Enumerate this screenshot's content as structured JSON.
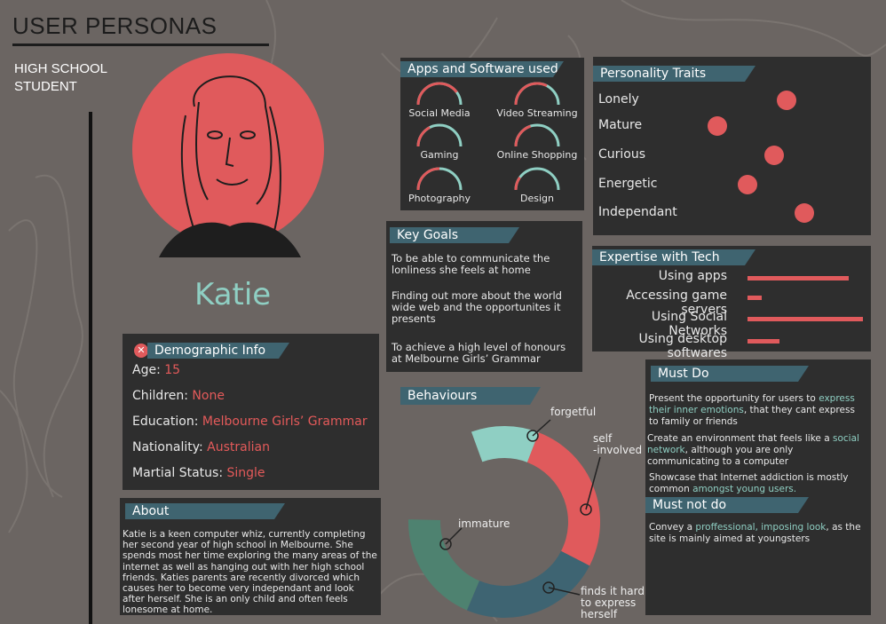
{
  "page": {
    "title": "USER PERSONAS",
    "subtitle": "HIGH SCHOOL STUDENT",
    "persona_name": "Katie"
  },
  "demographic": {
    "header": "Demographic Info",
    "rows": [
      {
        "label": "Age:",
        "value": "15"
      },
      {
        "label": "Children:",
        "value": "None"
      },
      {
        "label": "Education:",
        "value": "Melbourne Girls’ Grammar"
      },
      {
        "label": "Nationality:",
        "value": "Australian"
      },
      {
        "label": "Martial Status:",
        "value": "Single"
      }
    ]
  },
  "about": {
    "header": "About",
    "text": "Katie is a keen computer whiz, currently completing her second year of high school in Melbourne. She spends most her time exploring the many areas of the internet as well as hanging out with her high school friends. Katies parents are recently divorced which causes her to become very independant and look after herself. She is an only child and often feels lonesome at home."
  },
  "apps": {
    "header": "Apps and Software used",
    "items": [
      {
        "label": "Social Media",
        "level": 0.8
      },
      {
        "label": "Video Streaming",
        "level": 0.65
      },
      {
        "label": "Gaming",
        "level": 0.35
      },
      {
        "label": "Online Shopping",
        "level": 0.4
      },
      {
        "label": "Photography",
        "level": 0.5
      },
      {
        "label": "Design",
        "level": 0.2
      }
    ]
  },
  "goals": {
    "header": "Key Goals",
    "items": [
      "To be able to communicate the lonliness she feels at home",
      "Finding out more about the world wide web and the opportunites it presents",
      "To achieve a high level of honours at Melbourne Girls’ Grammar"
    ]
  },
  "traits": {
    "header": "Personality Traits",
    "items": [
      {
        "label": "Lonely",
        "level": 0.78
      },
      {
        "label": "Mature",
        "level": 0.5
      },
      {
        "label": "Curious",
        "level": 0.73
      },
      {
        "label": "Energetic",
        "level": 0.62
      },
      {
        "label": "Independant",
        "level": 0.85
      }
    ]
  },
  "tech": {
    "header": "Expertise with Tech",
    "items": [
      {
        "label": "Using apps",
        "level": 0.88
      },
      {
        "label": "Accessing game servers",
        "level": 0.12
      },
      {
        "label": "Using Social Networks",
        "level": 1.0
      },
      {
        "label": "Using desktop softwares",
        "level": 0.28
      }
    ]
  },
  "behaviours": {
    "header": "Behaviours"
  },
  "chart_data": {
    "type": "donut",
    "series": [
      {
        "name": "forgetful",
        "value": 12
      },
      {
        "name": "self -involved",
        "value": 28
      },
      {
        "name": "finds it hard to express herself",
        "value": 25
      },
      {
        "name": "immature",
        "value": 20
      }
    ],
    "labels": {
      "forgetful": "forgetful",
      "self_1": "self",
      "self_2": "-involved",
      "finds_1": "finds it hard",
      "finds_2": "to express",
      "finds_3": "herself",
      "immature": "immature"
    },
    "colors": [
      "#8fcfc3",
      "#e05a5c",
      "#3e6472",
      "#4e8270"
    ]
  },
  "mustdo": {
    "header": "Must Do",
    "p1_a": "Present the opportunity for users to ",
    "p1_b": "express their inner emotions",
    "p1_c": ", that they cant express to family or friends",
    "p2_a": "Create an environment that feels like a ",
    "p2_b": "social network",
    "p2_c": ", although you are only communicating to a computer",
    "p3_a": "Showcase that Internet addiction is mostly common ",
    "p3_b": "amongst young users."
  },
  "mustnot": {
    "header": "Must not do",
    "p1_a": "Convey a ",
    "p1_b": "proffessional, imposing look",
    "p1_c": ", as the site is mainly aimed at youngsters"
  },
  "colors": {
    "background": "#6b6562",
    "panel": "#2e2e2e",
    "accent": "#e05a5c",
    "teal": "#8fcfc3",
    "header_band": "#3f6470"
  }
}
